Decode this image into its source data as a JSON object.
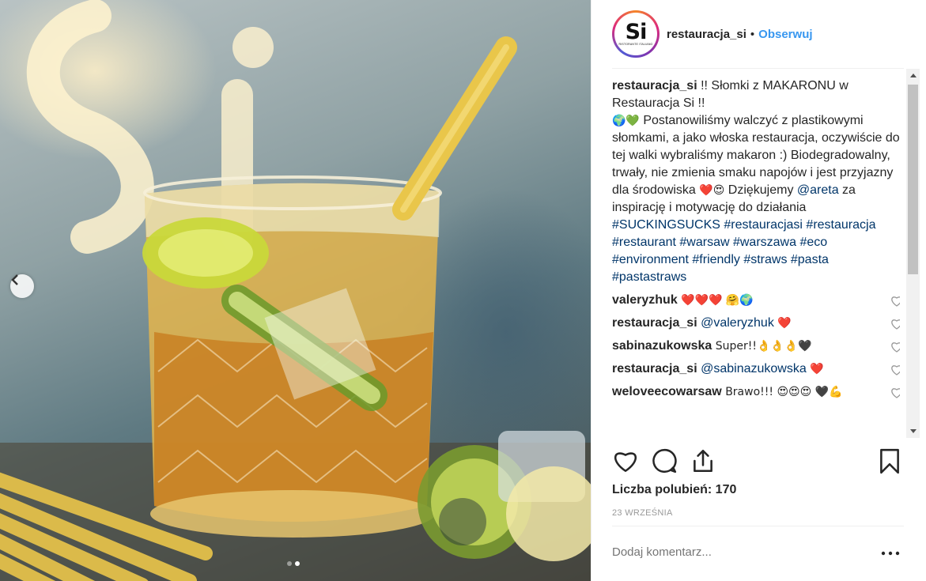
{
  "photo": {
    "carousel_dots": 2,
    "active_dot": 1
  },
  "header": {
    "username": "restauracja_si",
    "separator": "•",
    "follow_label": "Obserwuj",
    "avatar_text": "Si",
    "avatar_subtext": "RISTORANTE ITALIANO"
  },
  "caption": {
    "username": "restauracja_si",
    "text_1": " !! Słomki z MAKARONU w Restauracja Si !!",
    "emoji_1": "🌍💚",
    "text_2": " Postanowiliśmy walczyć z plastikowymi słomkami, a jako włoska restauracja, oczywiście do tej walki wybraliśmy makaron :) Biodegradowalny, trwały, nie zmienia smaku napojów i jest przyjazny dla środowiska ",
    "emoji_2": "❤️😍",
    "text_3": " Dziękujemy ",
    "mention": "@areta",
    "text_4": " za inspirację i motywację do działania ",
    "tag_1": "#SUCKINGSUCKS",
    "hashtags": "#restauracjasi #restauracja #restaurant #warsaw #warszawa #eco #environment #friendly #straws #pasta #pastastraws"
  },
  "comments": [
    {
      "username": "valeryzhuk",
      "text": " ❤️❤️❤️ 🤗🌍"
    },
    {
      "username": "restauracja_si",
      "mention": "@valeryzhuk",
      "text": " ❤️"
    },
    {
      "username": "sabinazukowska",
      "text": " Super!!👌👌👌🖤"
    },
    {
      "username": "restauracja_si",
      "mention": "@sabinazukowska",
      "text": " ❤️"
    },
    {
      "username": "weloveecowarsaw",
      "text": " Brawo!!! 😍😍😍 🖤💪"
    }
  ],
  "likes": "Liczba polubień: 170",
  "date": "23 WRZEŚNIA",
  "add_comment_placeholder": "Dodaj komentarz...",
  "more_label": "•••"
}
